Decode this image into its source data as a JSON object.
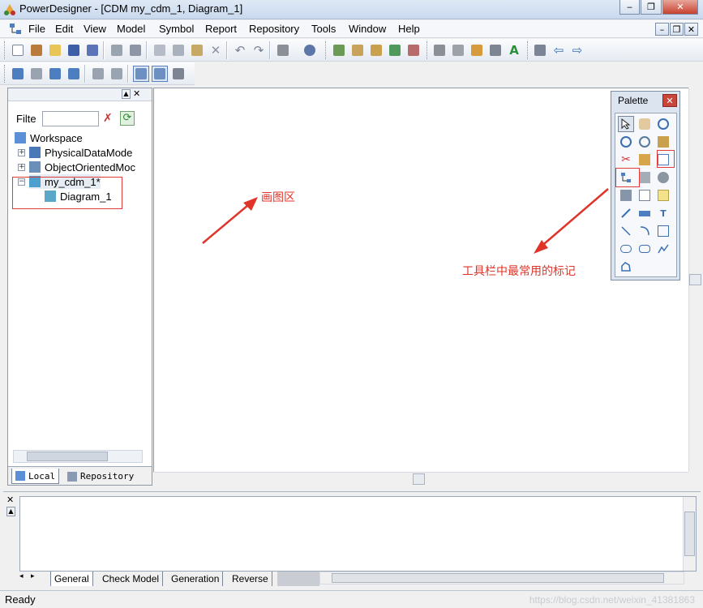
{
  "window": {
    "title": "PowerDesigner - [CDM my_cdm_1, Diagram_1]"
  },
  "window_controls": {
    "minimize": "‒",
    "restore": "❐",
    "close": "✕"
  },
  "mdi_controls": {
    "minimize": "–",
    "restore": "❐",
    "close": "✕"
  },
  "menu": [
    "File",
    "Edit",
    "View",
    "Model",
    "Symbol",
    "Report",
    "Repository",
    "Tools",
    "Window",
    "Help"
  ],
  "browser": {
    "filter_label": "Filte",
    "tree": [
      {
        "label": "Workspace"
      },
      {
        "label": "PhysicalDataMode"
      },
      {
        "label": "ObjectOrientedMoc"
      },
      {
        "label": "my_cdm_1*"
      },
      {
        "label": "Diagram_1"
      }
    ],
    "tabs": [
      "Local",
      "Repository"
    ]
  },
  "palette": {
    "title": "Palette",
    "close": "✕"
  },
  "annotations": {
    "drawing_area": "画图区",
    "toolbar_note": "工具栏中最常用的标记"
  },
  "output": {
    "tabs": [
      "General",
      "Check Model",
      "Generation",
      "Reverse"
    ]
  },
  "status": {
    "text": "Ready",
    "watermark": "https://blog.csdn.net/weixin_41381863"
  },
  "colors": {
    "annotation": "#e0342a",
    "accent": "#3a6fb0"
  }
}
